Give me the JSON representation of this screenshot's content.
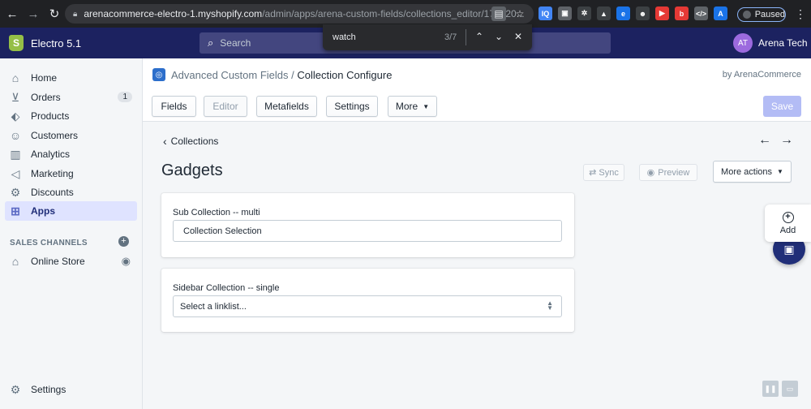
{
  "browser": {
    "url_host": "arenacommerce-electro-1.myshopify.com",
    "url_path": "/admin/apps/arena-custom-fields/collections_editor/172120...",
    "paused_label": "Paused",
    "find": {
      "query": "watch",
      "count": "3/7"
    },
    "extensions": [
      {
        "name": "iq-icon",
        "label": "IQ",
        "color": "#4285f4"
      },
      {
        "name": "page-icon",
        "label": "▣",
        "color": "#5f6368"
      },
      {
        "name": "puzzle-icon",
        "label": "✲",
        "color": "#3c4043"
      },
      {
        "name": "triangle-icon",
        "label": "▲",
        "color": "#3c4043"
      },
      {
        "name": "edge-icon",
        "label": "e",
        "color": "#1a73e8"
      },
      {
        "name": "user-icon",
        "label": "☻",
        "color": "#3c4043"
      },
      {
        "name": "youtube-icon",
        "label": "▶",
        "color": "#e53935"
      },
      {
        "name": "b-icon",
        "label": "b",
        "color": "#e53935"
      },
      {
        "name": "code-icon",
        "label": "</>",
        "color": "#5f6368"
      },
      {
        "name": "a-icon",
        "label": "A",
        "color": "#1a73e8"
      }
    ]
  },
  "topbar": {
    "store_name": "Electro 5.1",
    "store_logo_letter": "S",
    "search_placeholder": "Search",
    "avatar_initials": "AT",
    "account_name": "Arena Tech"
  },
  "sidebar": {
    "items": [
      {
        "label": "Home",
        "icon": "home-icon",
        "glyph": "⌂"
      },
      {
        "label": "Orders",
        "icon": "orders-icon",
        "glyph": "⊻",
        "badge": "1"
      },
      {
        "label": "Products",
        "icon": "tag-icon",
        "glyph": "⬖"
      },
      {
        "label": "Customers",
        "icon": "person-icon",
        "glyph": "☺"
      },
      {
        "label": "Analytics",
        "icon": "bar-chart-icon",
        "glyph": "▥"
      },
      {
        "label": "Marketing",
        "icon": "megaphone-icon",
        "glyph": "◁"
      },
      {
        "label": "Discounts",
        "icon": "discount-icon",
        "glyph": "⚙"
      },
      {
        "label": "Apps",
        "icon": "apps-icon",
        "glyph": "⊞"
      }
    ],
    "sales_channels_heading": "SALES CHANNELS",
    "online_store_label": "Online Store",
    "settings_label": "Settings"
  },
  "app": {
    "breadcrumb_app": "Advanced Custom Fields",
    "breadcrumb_sep": "/",
    "breadcrumb_current": "Collection Configure",
    "by_line": "by ArenaCommerce",
    "tabs": {
      "fields": "Fields",
      "editor": "Editor",
      "metafields": "Metafields",
      "settings": "Settings",
      "more": "More"
    },
    "save_label": "Save"
  },
  "page": {
    "back_label": "Collections",
    "title": "Gadgets",
    "sync_label": "Sync",
    "preview_label": "Preview",
    "more_actions_label": "More actions"
  },
  "fields": [
    {
      "label": "Sub Collection -- multi",
      "value": "Collection Selection"
    },
    {
      "label": "Sidebar Collection -- single",
      "value": "Select a linklist..."
    }
  ],
  "floating": {
    "add_label": "Add"
  }
}
